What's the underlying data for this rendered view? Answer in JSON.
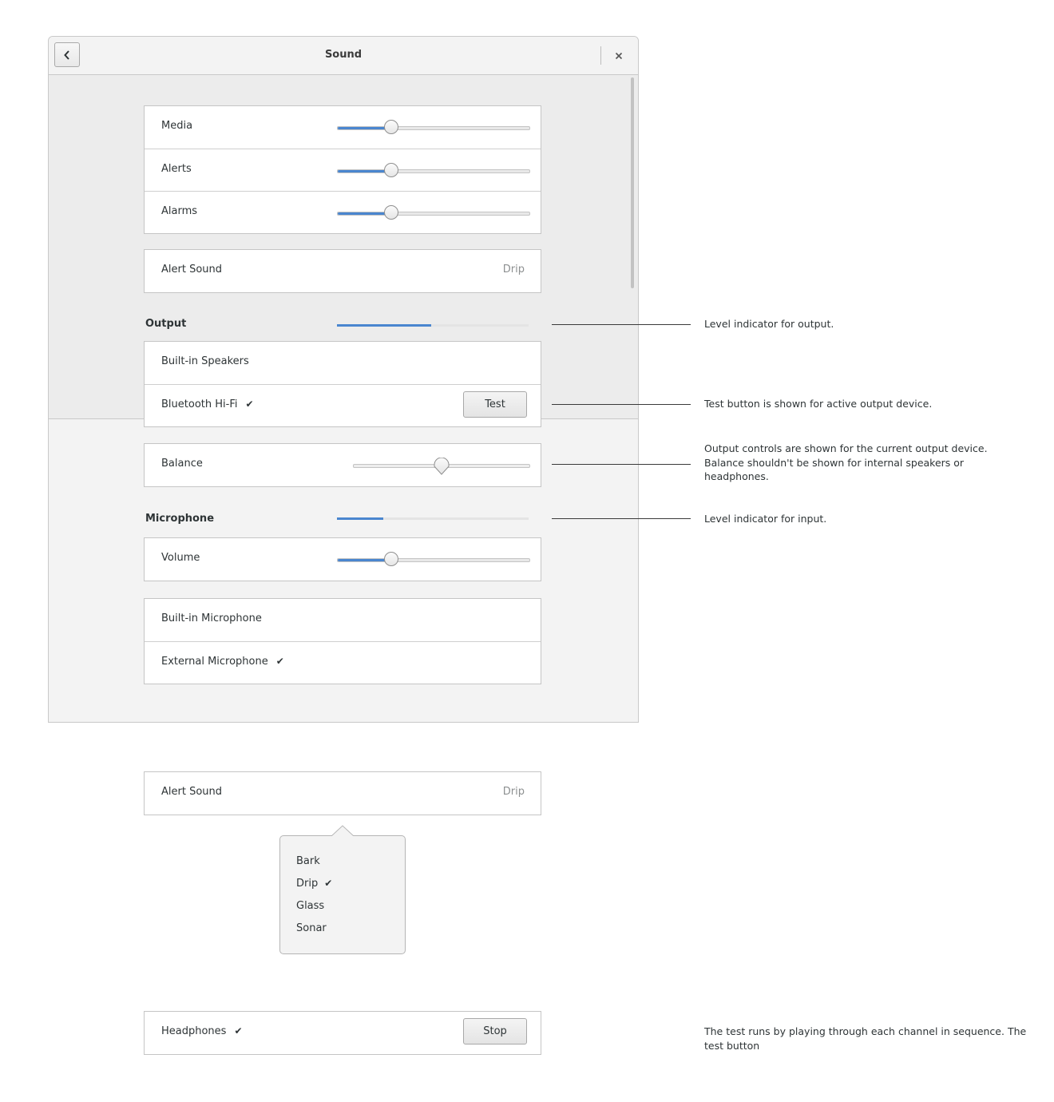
{
  "window": {
    "title": "Sound"
  },
  "volumes": [
    {
      "label": "Media",
      "level": 0.28
    },
    {
      "label": "Alerts",
      "level": 0.28
    },
    {
      "label": "Alarms",
      "level": 0.28
    }
  ],
  "alert_sound": {
    "label": "Alert Sound",
    "value": "Drip"
  },
  "output": {
    "title": "Output",
    "level": 0.49,
    "devices": [
      {
        "label": "Built-in Speakers",
        "active": false
      },
      {
        "label": "Bluetooth Hi-Fi",
        "active": true
      }
    ],
    "test_button": "Test",
    "balance": {
      "label": "Balance",
      "value": 0.5
    }
  },
  "microphone": {
    "title": "Microphone",
    "level": 0.24,
    "volume": {
      "label": "Volume",
      "level": 0.28
    },
    "devices": [
      {
        "label": "Built-in Microphone",
        "active": false
      },
      {
        "label": "External Microphone",
        "active": true
      }
    ]
  },
  "check_glyph": "✔",
  "annotations": {
    "output_level": "Level indicator for output.",
    "test_button": "Test button is shown for active output device.",
    "balance_1": "Output controls are shown for the current output device.",
    "balance_2": "Balance shouldn't be shown for internal speakers or",
    "balance_3": "headphones.",
    "input_level": "Level indicator for input.",
    "test_runs_1": "The test runs by playing through each channel in sequence. The",
    "test_runs_2": "test button"
  },
  "popover_example": {
    "label": "Alert Sound",
    "value": "Drip",
    "options": [
      "Bark",
      "Drip",
      "Glass",
      "Sonar"
    ],
    "selected": "Drip"
  },
  "headphones_example": {
    "label": "Headphones",
    "active": true,
    "button": "Stop"
  },
  "colors": {
    "accent": "#4a86cf",
    "window_bg": "#f3f3f3",
    "content_bg": "#ececec",
    "border": "#c5c5c5"
  },
  "icons": {
    "back": "chevron-left-icon",
    "close": "close-icon",
    "check": "checkmark-icon"
  }
}
